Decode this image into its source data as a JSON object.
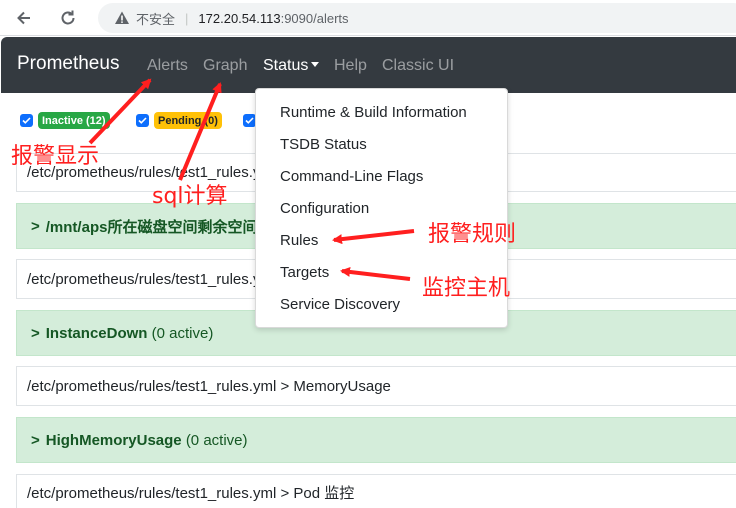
{
  "browser": {
    "insecure_label": "不安全",
    "url_host": "172.20.54.113",
    "url_path": ":9090/alerts"
  },
  "navbar": {
    "brand": "Prometheus",
    "links": [
      "Alerts",
      "Graph",
      "Status",
      "Help",
      "Classic UI"
    ]
  },
  "filters": [
    {
      "label": "Inactive (12)",
      "color": "#28a745"
    },
    {
      "label": "Pending (0)",
      "color": "#ffc107"
    }
  ],
  "rules": {
    "file1": "/etc/prometheus/rules/test1_rules.yml",
    "group1": "/mnt/aps所在磁盘空间剩余空间",
    "file2": "/etc/prometheus/rules/test1_rules.yml",
    "group2": {
      "name": "InstanceDown",
      "count": "(0 active)"
    },
    "file3": "/etc/prometheus/rules/test1_rules.yml > MemoryUsage",
    "group3": {
      "name": "HighMemoryUsage",
      "count": "(0 active)"
    },
    "file4": "/etc/prometheus/rules/test1_rules.yml > Pod 监控"
  },
  "status_menu": [
    "Runtime & Build Information",
    "TSDB Status",
    "Command-Line Flags",
    "Configuration",
    "Rules",
    "Targets",
    "Service Discovery"
  ],
  "annotations": {
    "alerts": "报警显示",
    "graph": "sql计算",
    "rules": "报警规则",
    "targets": "监控主机"
  },
  "colors": {
    "navbar": "#343a40",
    "annotation": "#ff1f1f",
    "group_bg": "#d4edda"
  }
}
